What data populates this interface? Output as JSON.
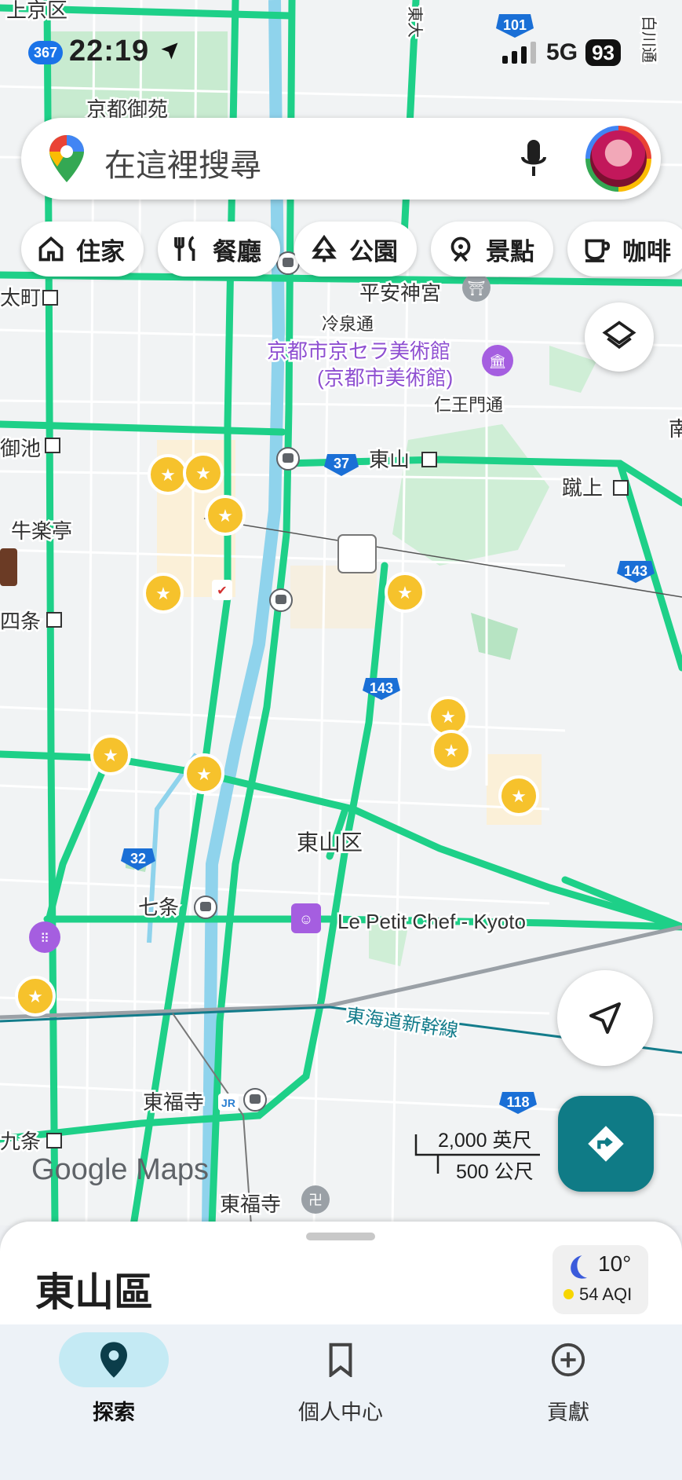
{
  "status_bar": {
    "badge": "367",
    "time": "22:19",
    "network": "5G",
    "battery": "93",
    "icons": [
      "location-arrow-icon",
      "signal-icon"
    ]
  },
  "search": {
    "placeholder": "在這裡搜尋",
    "icons": [
      "google-maps-pin-icon",
      "microphone-icon",
      "profile-avatar"
    ]
  },
  "chips": [
    {
      "label": "住家",
      "icon": "home-icon"
    },
    {
      "label": "餐廳",
      "icon": "restaurant-icon"
    },
    {
      "label": "公園",
      "icon": "park-icon"
    },
    {
      "label": "景點",
      "icon": "attraction-icon"
    },
    {
      "label": "咖啡",
      "icon": "coffee-icon"
    }
  ],
  "map": {
    "labels": {
      "kamigyo": "上京区",
      "gosho": "京都御苑",
      "heian": "平安神宮",
      "reisen": "冷泉通",
      "museum1": "京都市京セラ美術館",
      "museum2": "(京都市美術館)",
      "nio": "仁王門通",
      "higashiyama_st": "東山",
      "keage": "蹴上",
      "oike": "御池",
      "gyuraku": "牛楽亭",
      "shijo": "四条",
      "ward": "東山区",
      "shichijo": "七条",
      "petit": "Le Petit Chef - Kyoto",
      "shinkansen": "東海道新幹線",
      "tofukuji_st": "東福寺",
      "tofukuji_temple": "東福寺",
      "kujo": "九条",
      "dori": "太町",
      "minami": "南",
      "shirakawa": "白川通",
      "east": "東大"
    },
    "route_shields": [
      "101",
      "37",
      "143",
      "143",
      "32",
      "118"
    ],
    "scale": {
      "imperial": "2,000 英尺",
      "metric": "500 公尺"
    },
    "logo": "Google Maps",
    "colors": {
      "traffic_green": "#1ed088",
      "shield": "#1a6fd6",
      "star": "#f6c22c",
      "water": "#8fd3ec",
      "accent": "#0f7b86"
    }
  },
  "sheet": {
    "title": "東山區",
    "weather_temp": "10°",
    "aqi": "54 AQI"
  },
  "bottom_nav": [
    {
      "label": "探索",
      "icon": "explore-pin-icon",
      "active": true
    },
    {
      "label": "個人中心",
      "icon": "bookmark-icon",
      "active": false
    },
    {
      "label": "貢獻",
      "icon": "add-circle-icon",
      "active": false
    }
  ]
}
